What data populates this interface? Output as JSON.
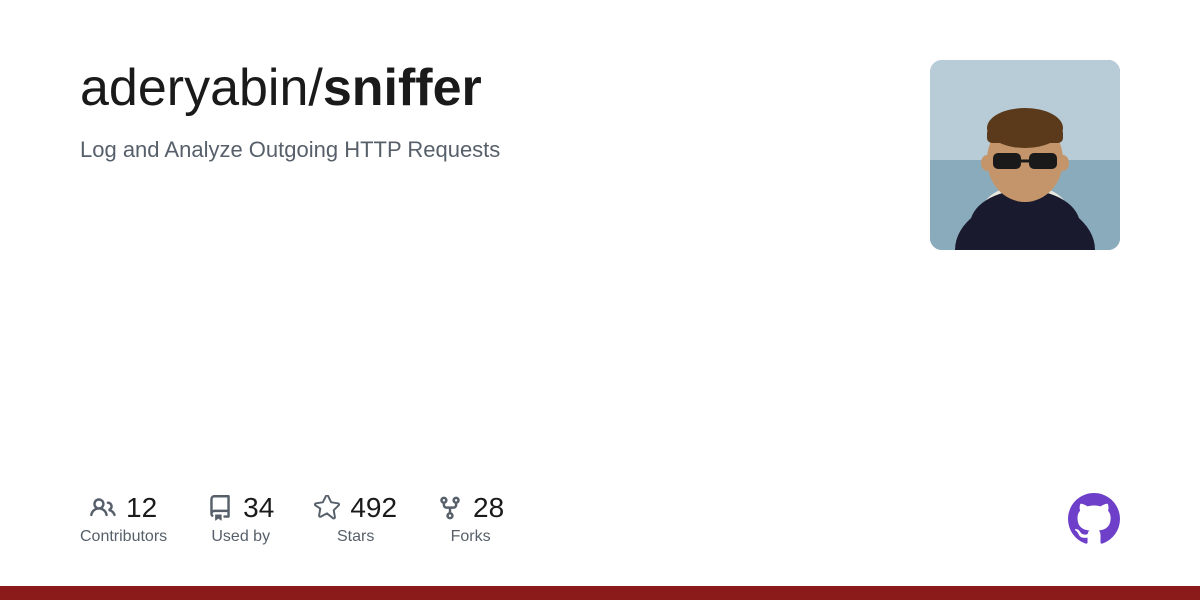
{
  "repo": {
    "owner": "aderyabin/",
    "name": "sniffer",
    "description": "Log and Analyze Outgoing HTTP Requests"
  },
  "stats": {
    "contributors": {
      "count": "12",
      "label": "Contributors"
    },
    "used_by": {
      "count": "34",
      "label": "Used by"
    },
    "stars": {
      "count": "492",
      "label": "Stars"
    },
    "forks": {
      "count": "28",
      "label": "Forks"
    }
  },
  "bottom_bar": {
    "color": "#8b1a1a"
  }
}
